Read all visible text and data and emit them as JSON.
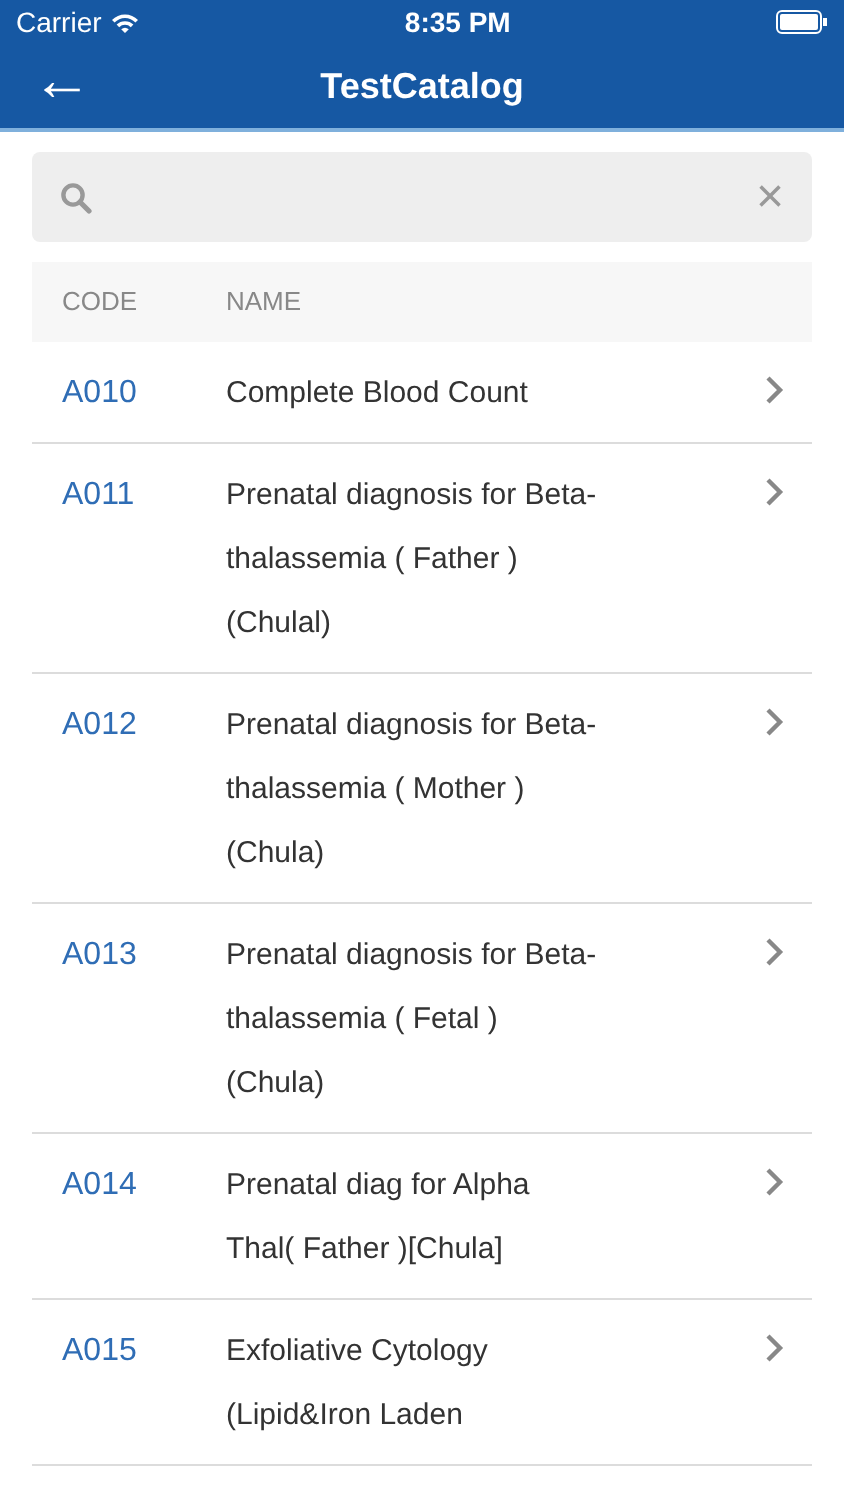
{
  "status_bar": {
    "carrier": "Carrier",
    "time": "8:35 PM"
  },
  "nav": {
    "back": "←",
    "title": "TestCatalog"
  },
  "search": {
    "clear": "×"
  },
  "table": {
    "columns": [
      "CODE",
      "NAME"
    ],
    "rows": [
      {
        "code": "A010",
        "name": "Complete Blood Count"
      },
      {
        "code": "A011",
        "name": "Prenatal diagnosis for Beta-thalassemia ( Father ) (Chulal)"
      },
      {
        "code": "A012",
        "name": "Prenatal diagnosis for Beta-thalassemia ( Mother ) (Chula)"
      },
      {
        "code": "A013",
        "name": "Prenatal diagnosis for Beta-thalassemia ( Fetal ) (Chula)"
      },
      {
        "code": "A014",
        "name": "Prenatal diag for Alpha Thal( Father )[Chula]"
      },
      {
        "code": "A015",
        "name": "Exfoliative Cytology (Lipid&Iron Laden"
      }
    ]
  }
}
